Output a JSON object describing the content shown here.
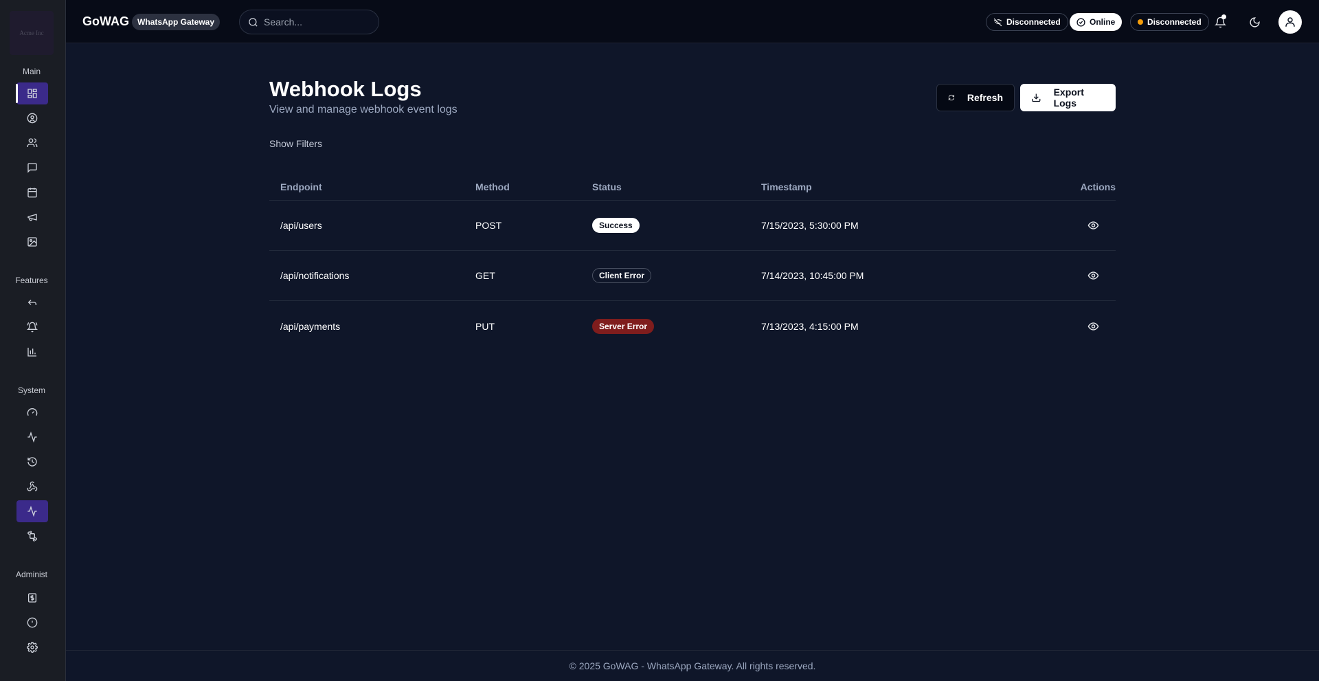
{
  "sidebar": {
    "logo_text": "Acme Inc",
    "sections": {
      "main": "Main",
      "features": "Features",
      "system": "System",
      "administration": "Administ"
    },
    "items": [
      {
        "icon": "dashboard-icon"
      },
      {
        "icon": "user-circle-icon"
      },
      {
        "icon": "users-icon"
      },
      {
        "icon": "message-icon"
      },
      {
        "icon": "calendar-icon"
      },
      {
        "icon": "megaphone-icon"
      },
      {
        "icon": "image-icon"
      },
      {
        "icon": "reply-icon"
      },
      {
        "icon": "bell-ring-icon"
      },
      {
        "icon": "bar-chart-icon"
      },
      {
        "icon": "gauge-icon"
      },
      {
        "icon": "activity-icon"
      },
      {
        "icon": "history-icon"
      },
      {
        "icon": "webhook-icon"
      },
      {
        "icon": "activity-icon"
      },
      {
        "icon": "puzzle-icon"
      },
      {
        "icon": "billing-icon"
      },
      {
        "icon": "alert-circle-icon"
      },
      {
        "icon": "settings-icon"
      }
    ]
  },
  "header": {
    "app_name": "GoWAG",
    "app_badge": "WhatsApp Gateway",
    "search_placeholder": "Search...",
    "status_wifi": "Disconnected",
    "status_online": "Online",
    "status_ws": "Disconnected"
  },
  "page": {
    "title": "Webhook Logs",
    "subtitle": "View and manage webhook event logs",
    "refresh_label": "Refresh",
    "export_label": "Export Logs",
    "filters_label": "Show Filters"
  },
  "table": {
    "headers": {
      "endpoint": "Endpoint",
      "method": "Method",
      "status": "Status",
      "timestamp": "Timestamp",
      "actions": "Actions"
    },
    "rows": [
      {
        "endpoint": "/api/users",
        "method": "POST",
        "status": "Success",
        "timestamp": "7/15/2023, 5:30:00 PM"
      },
      {
        "endpoint": "/api/notifications",
        "method": "GET",
        "status": "Client Error",
        "timestamp": "7/14/2023, 10:45:00 PM"
      },
      {
        "endpoint": "/api/payments",
        "method": "PUT",
        "status": "Server Error",
        "timestamp": "7/13/2023, 4:15:00 PM"
      }
    ]
  },
  "footer": {
    "text": "© 2025 GoWAG - WhatsApp Gateway. All rights reserved."
  },
  "colors": {
    "background": "#0f1629",
    "sidebar": "#1a1d24",
    "accent": "#3b2a8a",
    "error": "#7f1d1d",
    "warning": "#f59e0b"
  }
}
